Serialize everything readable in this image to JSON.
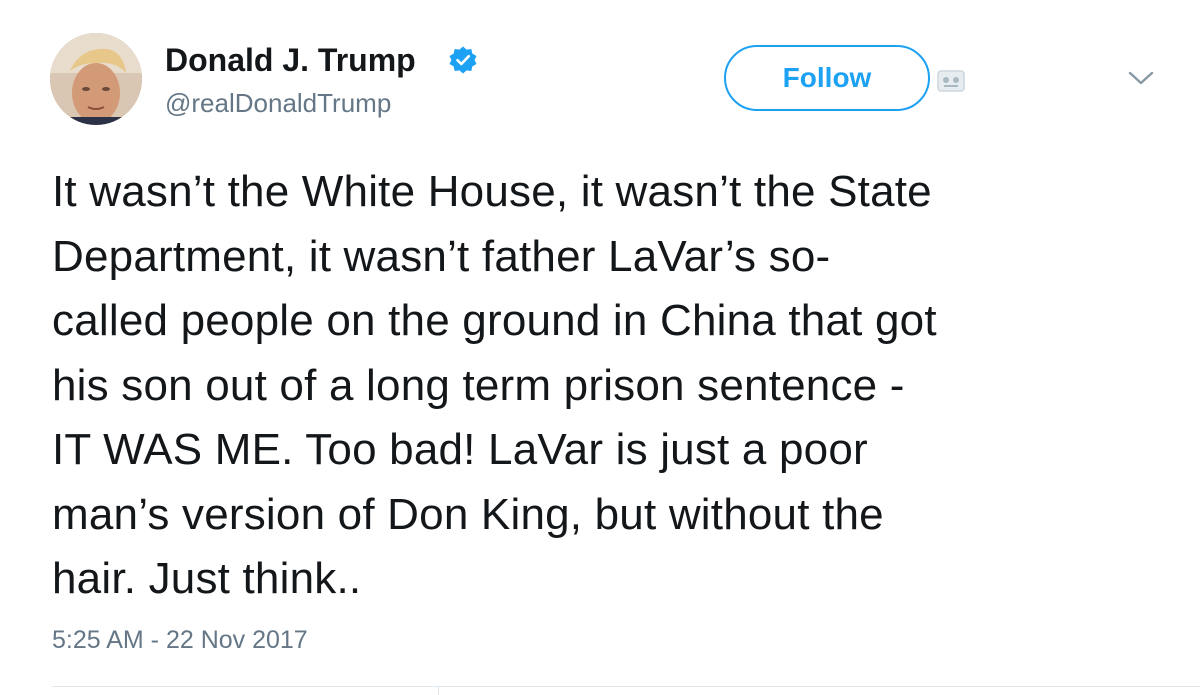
{
  "tweet": {
    "author": {
      "display_name": "Donald J. Trump",
      "handle": "@realDonaldTrump",
      "verified": true,
      "verified_icon": "verified-badge-icon",
      "avatar_icon": "profile-photo"
    },
    "follow_label": "Follow",
    "text_lines": [
      "It wasn’t the White House, it wasn’t the State",
      "Department, it wasn’t father LaVar’s so-",
      "called people on the ground in China that got",
      "his son out of a long term prison sentence -",
      "IT WAS ME. Too bad! LaVar is just a poor",
      "man’s version of Don King, but without the",
      "hair. Just think.."
    ],
    "timestamp": "5:25 AM - 22 Nov 2017"
  },
  "colors": {
    "accent": "#1da1f2",
    "text": "#14171a",
    "secondary_text": "#657786",
    "divider": "#e1e8ed"
  },
  "icons": {
    "follow_extra": "notification-icon",
    "more": "chevron-down-icon"
  }
}
